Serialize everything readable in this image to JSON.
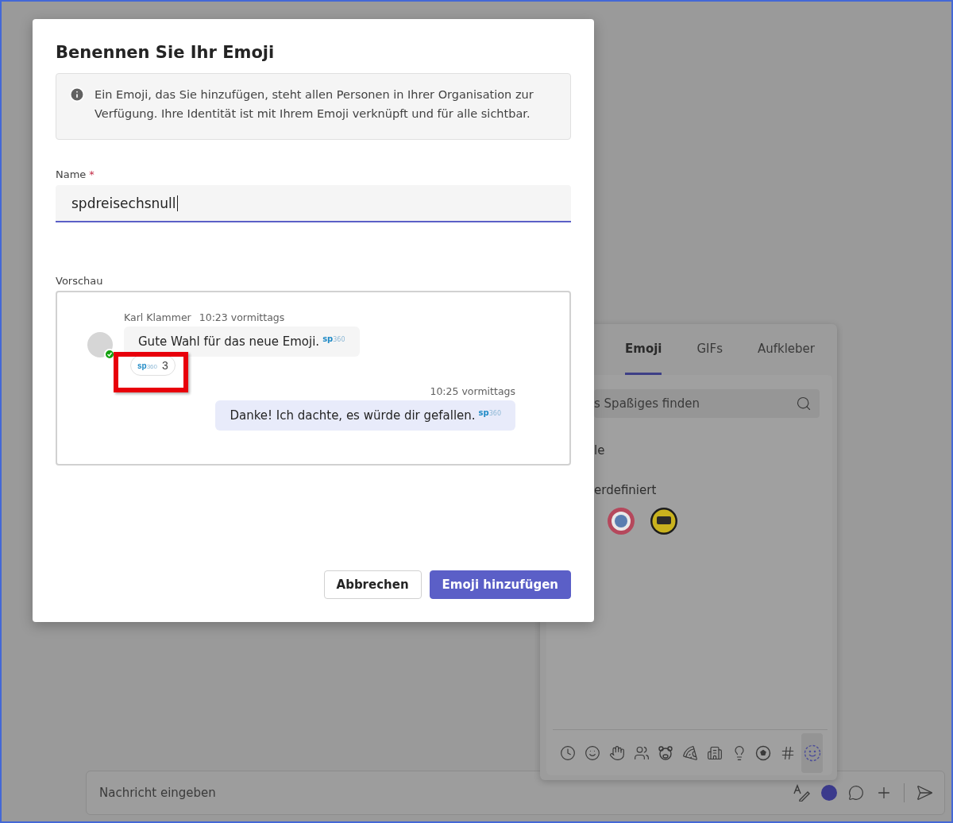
{
  "dialog": {
    "title": "Benennen Sie Ihr Emoji",
    "info": "Ein Emoji, das Sie hinzufügen, steht allen Personen in Ihrer Organisation zur Verfügung. Ihre Identität ist mit Ihrem Emoji verknüpft und für alle sichtbar.",
    "name_field": {
      "label": "Name",
      "required_mark": "*",
      "value": "spdreisechsnull",
      "focused": true
    },
    "preview": {
      "label": "Vorschau",
      "messages": [
        {
          "kind": "received",
          "author": "Karl Klammer",
          "time": "10:23 vormittags",
          "online": true,
          "text": "Gute Wahl für das neue Emoji.",
          "emoji": "**sp**360",
          "reactions": [
            {
              "emoji": "**sp**360",
              "count": "3"
            }
          ]
        },
        {
          "kind": "sent",
          "time": "10:25 vormittags",
          "text": "Danke! Ich dachte, es würde dir gefallen.",
          "emoji": "**sp**360"
        }
      ]
    },
    "buttons": [
      {
        "label": "Abbrechen",
        "kind": "secondary"
      },
      {
        "label": "Emoji hinzufügen",
        "kind": "primary"
      }
    ]
  },
  "picker": {
    "tabs": [
      {
        "label": "Emoji",
        "selected": true
      },
      {
        "label": "GIFs",
        "selected": false
      },
      {
        "label": "Aufkleber",
        "selected": false
      }
    ],
    "search": {
      "placeholder": "s Spaßiges finden"
    },
    "sections": [
      {
        "title": "le"
      },
      {
        "title": "erdefiniert",
        "emojis": [
          {
            "kind": "red-crest"
          },
          {
            "kind": "yellow-crest"
          }
        ]
      }
    ],
    "categories": [
      {
        "kind": "recent",
        "selected": false
      },
      {
        "kind": "smileys",
        "selected": false
      },
      {
        "kind": "hand",
        "selected": false
      },
      {
        "kind": "people",
        "selected": false
      },
      {
        "kind": "animals",
        "selected": false
      },
      {
        "kind": "food",
        "selected": false
      },
      {
        "kind": "buildings",
        "selected": false
      },
      {
        "kind": "objects",
        "selected": false
      },
      {
        "kind": "activities",
        "selected": false
      },
      {
        "kind": "symbols",
        "selected": false
      },
      {
        "kind": "custom",
        "selected": true
      }
    ]
  },
  "compose": {
    "placeholder": "Nachricht eingeben"
  }
}
